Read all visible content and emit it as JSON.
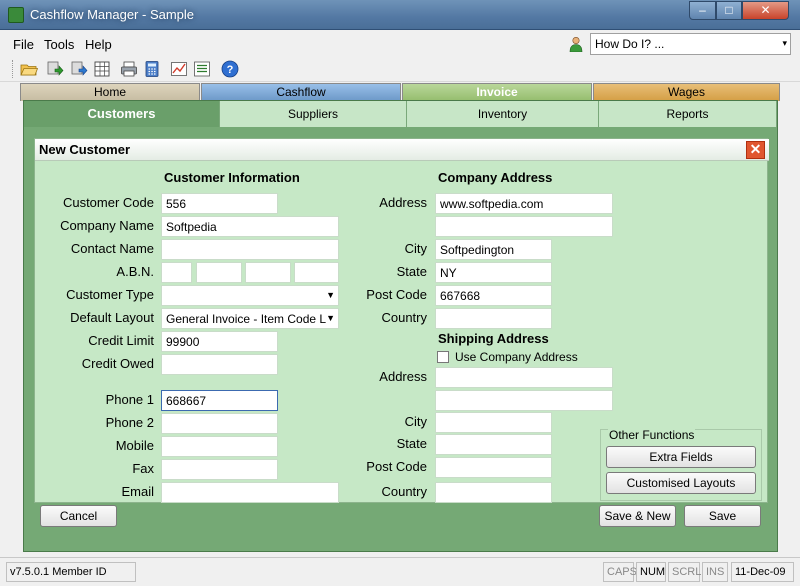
{
  "window": {
    "title": "Cashflow Manager - Sample",
    "minimize": "–",
    "maximize": "□",
    "close": "✕"
  },
  "menu": [
    "File",
    "Tools",
    "Help"
  ],
  "howdoi": {
    "text": "How Do I? ...",
    "arrow": "▾"
  },
  "toolbar": {
    "icons": [
      "open-folder-icon",
      "green-arrow-icon",
      "green-arrow-alt-icon",
      "grid-icon",
      "separator",
      "print-icon",
      "calculator-icon",
      "separator",
      "chart-icon",
      "list-icon",
      "separator",
      "help-icon"
    ]
  },
  "tabs": [
    {
      "label": "Home",
      "color": "#ccc2a8"
    },
    {
      "label": "Cashflow",
      "color": "#7ba7d6"
    },
    {
      "label": "Invoice",
      "color": "#a5c783"
    },
    {
      "label": "Wages",
      "color": "#d9a95a"
    }
  ],
  "subtabs": [
    "Customers",
    "Suppliers",
    "Inventory",
    "Reports"
  ],
  "panel": {
    "title": "New Customer",
    "close": "✕"
  },
  "customer_info": {
    "heading": "Customer Information",
    "customer_code": {
      "label": "Customer Code",
      "value": "556"
    },
    "company_name": {
      "label": "Company Name",
      "value": "Softpedia"
    },
    "contact_name": {
      "label": "Contact Name",
      "value": ""
    },
    "abn": {
      "label": "A.B.N."
    },
    "customer_type": {
      "label": "Customer Type",
      "value": ""
    },
    "default_layout": {
      "label": "Default Layout",
      "value": "General Invoice - Item Code L"
    },
    "credit_limit": {
      "label": "Credit Limit",
      "value": "99900"
    },
    "credit_owed": {
      "label": "Credit Owed",
      "value": ""
    },
    "phone1": {
      "label": "Phone 1",
      "value": "668667"
    },
    "phone2": {
      "label": "Phone 2",
      "value": ""
    },
    "mobile": {
      "label": "Mobile",
      "value": ""
    },
    "fax": {
      "label": "Fax",
      "value": ""
    },
    "email": {
      "label": "Email",
      "value": ""
    }
  },
  "company_address": {
    "heading": "Company Address",
    "address": {
      "label": "Address",
      "line1": "www.softpedia.com",
      "line2": ""
    },
    "city": {
      "label": "City",
      "value": "Softpedington"
    },
    "state": {
      "label": "State",
      "value": "NY"
    },
    "post_code": {
      "label": "Post Code",
      "value": "667668"
    },
    "country": {
      "label": "Country",
      "value": ""
    }
  },
  "shipping_address": {
    "heading": "Shipping Address",
    "use_company": "Use Company Address",
    "address": {
      "label": "Address"
    },
    "city": {
      "label": "City"
    },
    "state": {
      "label": "State"
    },
    "post_code": {
      "label": "Post Code"
    },
    "country": {
      "label": "Country"
    }
  },
  "other_functions": {
    "label": "Other Functions",
    "extra_fields": "Extra Fields",
    "customised_layouts": "Customised Layouts"
  },
  "buttons": {
    "cancel": "Cancel",
    "save_new": "Save & New",
    "save": "Save"
  },
  "status": {
    "version": "v7.5.0.1 Member ID",
    "caps": "CAPS",
    "num": "NUM",
    "scrl": "SCRL",
    "ins": "INS",
    "date": "11-Dec-09"
  }
}
